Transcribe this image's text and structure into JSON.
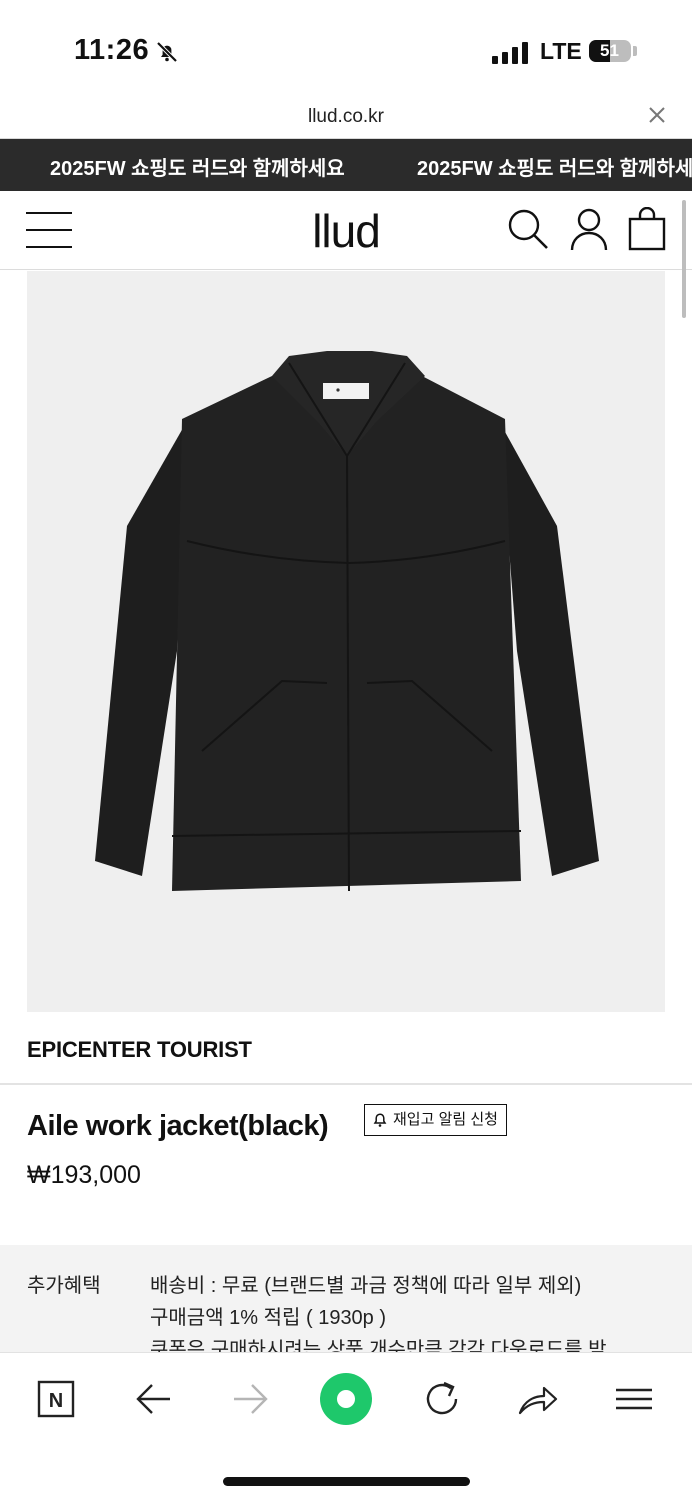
{
  "status_bar": {
    "time": "11:26",
    "network": "LTE",
    "battery": "51",
    "battery_level": 0.51
  },
  "browser": {
    "url": "llud.co.kr"
  },
  "announcement": {
    "text": "2025FW 쇼핑도 러드와 함께하세요"
  },
  "header": {
    "logo": "llud"
  },
  "product": {
    "brand": "EPICENTER TOURIST",
    "name": "Aile work jacket(black)",
    "restock_label": "재입고 알림 신청",
    "price": "₩193,000"
  },
  "benefits": {
    "label": "추가혜택",
    "lines": [
      "배송비 : 무료 (브랜드별 과금 정책에 따라 일부 제외)",
      "구매금액 1% 적립 ( 1930p )",
      "쿠폰은 구매하시려는 상품 개수만큼 각각 다운로드를 받"
    ]
  },
  "toolbar": {
    "naver_label": "N"
  },
  "colors": {
    "banner_bg": "#2b2b2b",
    "image_bg": "#efefef",
    "accent_green": "#1ec86b"
  }
}
